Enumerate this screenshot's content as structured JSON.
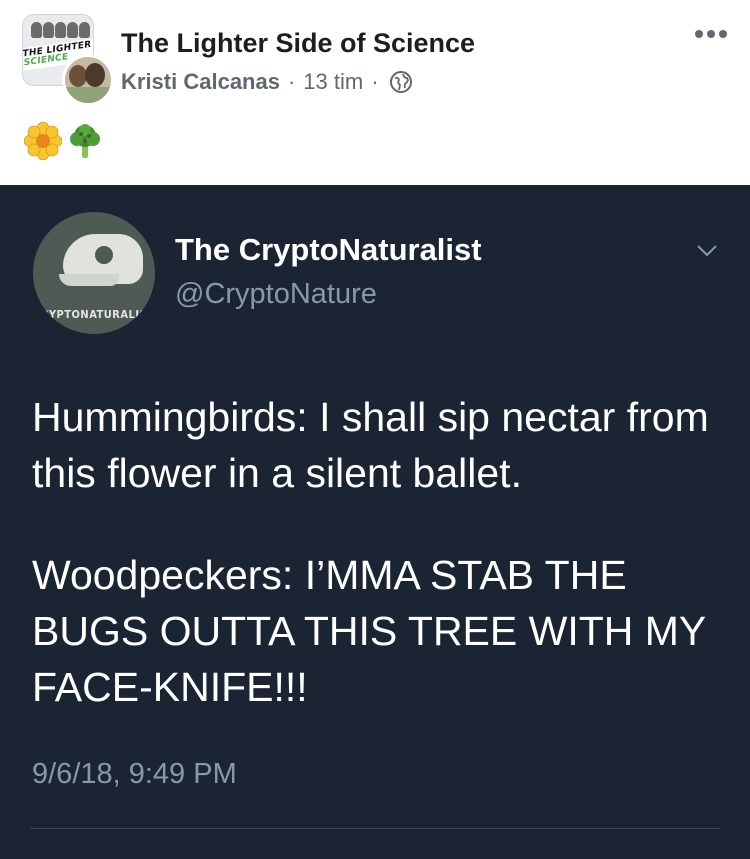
{
  "post": {
    "group_name": "The Lighter Side of Science",
    "author": "Kristi Calcanas",
    "time": "13 tim",
    "separator": "·",
    "privacy_icon": "globe-icon",
    "menu_icon": "more-dots-icon",
    "emojis": [
      "blossom-icon",
      "broccoli-icon"
    ]
  },
  "tweet": {
    "name": "The CryptoNaturalist",
    "handle": "@CryptoNature",
    "avatar_label": "CRYPTONATURALIST",
    "paragraphs": [
      "Hummingbirds: I shall sip nectar from this flower in a silent ballet.",
      "Woodpeckers: I’MMA STAB THE BUGS OUTTA THIS TREE WITH MY FACE-KNIFE!!!"
    ],
    "timestamp": "9/6/18, 9:49 PM",
    "menu_icon": "chevron-down-icon"
  },
  "colors": {
    "tweet_background": "#1a2433",
    "secondary_text": "#8899a6",
    "facebook_meta": "#606770"
  }
}
